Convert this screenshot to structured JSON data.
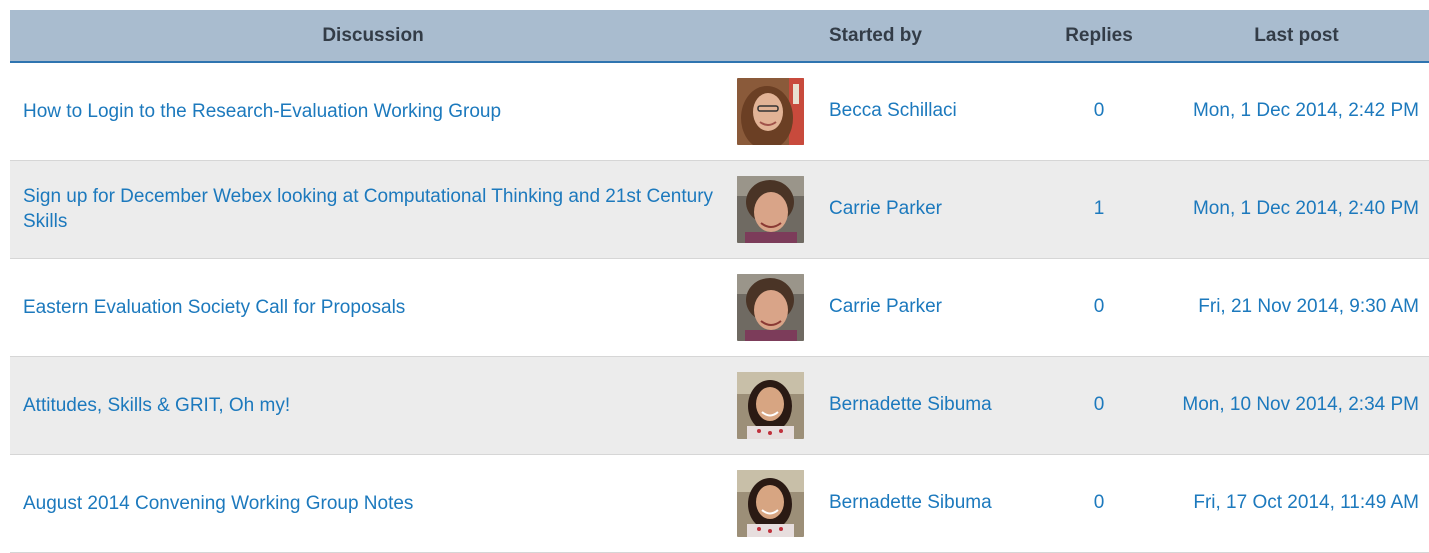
{
  "header": {
    "discussion": "Discussion",
    "started_by": "Started by",
    "replies": "Replies",
    "last_post": "Last post"
  },
  "rows": [
    {
      "title": "How to Login to the Research-Evaluation Working Group",
      "author": "Becca Schillaci",
      "replies": "0",
      "last_post": "Mon, 1 Dec 2014, 2:42 PM",
      "avatar": "avatar-becca-icon"
    },
    {
      "title": "Sign up for December Webex looking at Computational Thinking and 21st Century Skills",
      "author": "Carrie Parker",
      "replies": "1",
      "last_post": "Mon, 1 Dec 2014, 2:40 PM",
      "avatar": "avatar-carrie-icon"
    },
    {
      "title": "Eastern Evaluation Society Call for Proposals",
      "author": "Carrie Parker",
      "replies": "0",
      "last_post": "Fri, 21 Nov 2014, 9:30 AM",
      "avatar": "avatar-carrie-icon"
    },
    {
      "title": "Attitudes, Skills & GRIT, Oh my!",
      "author": "Bernadette Sibuma",
      "replies": "0",
      "last_post": "Mon, 10 Nov 2014, 2:34 PM",
      "avatar": "avatar-bernadette-icon"
    },
    {
      "title": "August 2014 Convening Working Group Notes",
      "author": "Bernadette Sibuma",
      "replies": "0",
      "last_post": "Fri, 17 Oct 2014, 11:49 AM",
      "avatar": "avatar-bernadette-icon"
    }
  ],
  "colors": {
    "header_bg": "#a9bccf",
    "header_border": "#2f74b0",
    "link": "#1c79bd",
    "alt_row": "#ececec"
  }
}
